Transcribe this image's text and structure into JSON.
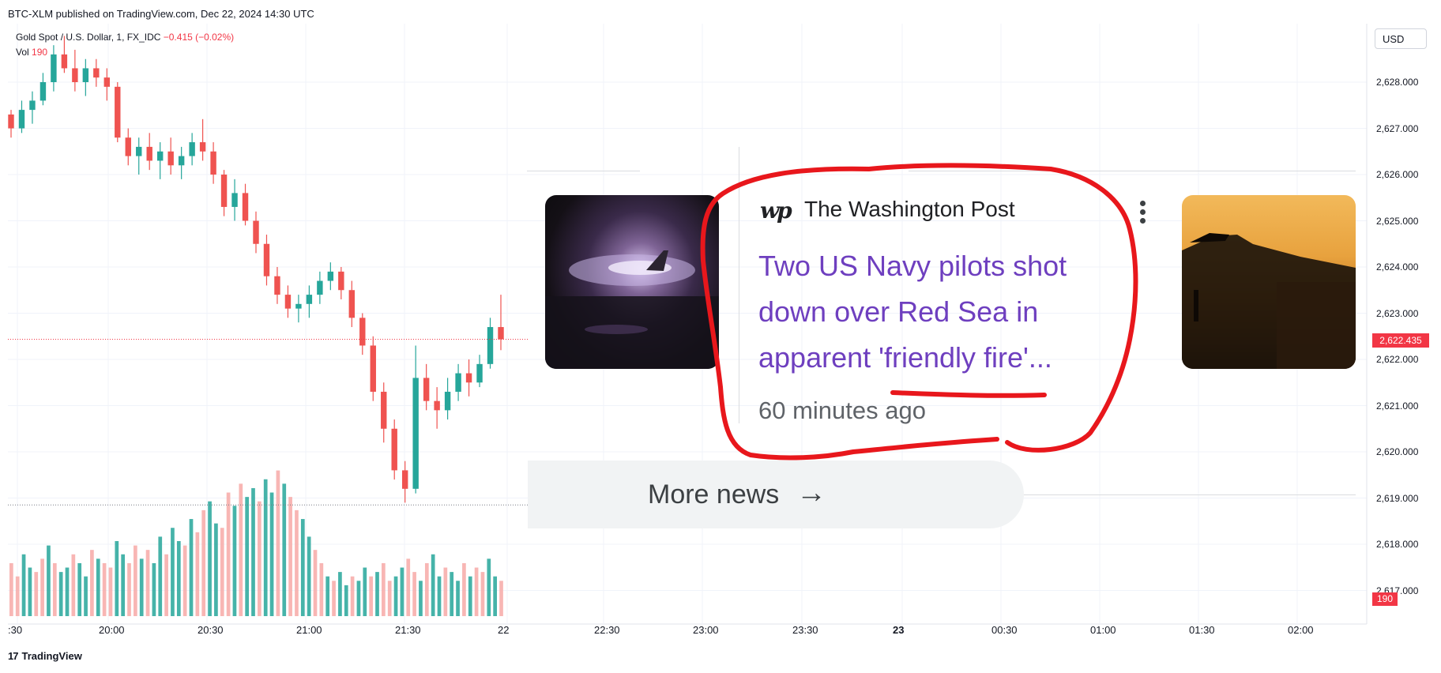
{
  "header": {
    "publish_line": "BTC-XLM published on TradingView.com, Dec 22, 2024 14:30 UTC"
  },
  "legend": {
    "symbol_line": "Gold Spot / U.S. Dollar, 1, FX_IDC",
    "change": "−0.415 (−0.02%)",
    "vol_label": "Vol",
    "vol_value": "190"
  },
  "currency_button": "USD",
  "price_axis": [
    "2,628.000",
    "2,627.000",
    "2,626.000",
    "2,625.000",
    "2,624.000",
    "2,623.000",
    "2,622.000",
    "2,621.000",
    "2,620.000",
    "2,619.000",
    "2,618.000",
    "2,617.000"
  ],
  "current_price": "2,622.435",
  "current_volume": "190",
  "time_axis": [
    ":30",
    "20:00",
    "20:30",
    "21:00",
    "21:30",
    "22",
    "22:30",
    "23:00",
    "23:30",
    "23",
    "00:30",
    "01:00",
    "01:30",
    "02:00"
  ],
  "footer": {
    "brand": "TradingView"
  },
  "news": {
    "source": "The Washington Post",
    "logo_text": "wp",
    "headline": "Two US Navy pilots shot down over Red Sea in apparent 'friendly fire'...",
    "time_ago": "60 minutes ago",
    "more_news": "More news"
  },
  "colors": {
    "up": "#26a69a",
    "down": "#ef5350",
    "accent": "#f23645",
    "headline": "#6e3fbf",
    "annotation": "#e8171c"
  },
  "chart_data": {
    "type": "candlestick",
    "symbol": "Gold Spot / U.S. Dollar",
    "interval": "1",
    "ylim": [
      2616.8,
      2629.0
    ],
    "last": 2622.435,
    "low_line": 2618.85,
    "ohlc": [
      [
        2627.3,
        2627.4,
        2626.8,
        2627.0
      ],
      [
        2627.0,
        2627.6,
        2626.9,
        2627.4
      ],
      [
        2627.4,
        2627.8,
        2627.1,
        2627.6
      ],
      [
        2627.6,
        2628.2,
        2627.5,
        2628.0
      ],
      [
        2628.0,
        2628.8,
        2627.8,
        2628.6
      ],
      [
        2628.6,
        2629.0,
        2628.2,
        2628.3
      ],
      [
        2628.3,
        2628.7,
        2627.8,
        2628.0
      ],
      [
        2628.0,
        2628.5,
        2627.7,
        2628.3
      ],
      [
        2628.3,
        2628.5,
        2627.9,
        2628.1
      ],
      [
        2628.1,
        2628.3,
        2627.6,
        2627.9
      ],
      [
        2627.9,
        2628.0,
        2626.7,
        2626.8
      ],
      [
        2626.8,
        2627.0,
        2626.2,
        2626.4
      ],
      [
        2626.4,
        2626.8,
        2626.0,
        2626.6
      ],
      [
        2626.6,
        2626.9,
        2626.1,
        2626.3
      ],
      [
        2626.3,
        2626.7,
        2625.9,
        2626.5
      ],
      [
        2626.5,
        2626.8,
        2626.0,
        2626.2
      ],
      [
        2626.2,
        2626.6,
        2625.9,
        2626.4
      ],
      [
        2626.4,
        2626.9,
        2626.2,
        2626.7
      ],
      [
        2626.7,
        2627.2,
        2626.3,
        2626.5
      ],
      [
        2626.5,
        2626.7,
        2625.8,
        2626.0
      ],
      [
        2626.0,
        2626.1,
        2625.1,
        2625.3
      ],
      [
        2625.3,
        2625.9,
        2625.0,
        2625.6
      ],
      [
        2625.6,
        2625.8,
        2624.9,
        2625.0
      ],
      [
        2625.0,
        2625.2,
        2624.3,
        2624.5
      ],
      [
        2624.5,
        2624.7,
        2623.6,
        2623.8
      ],
      [
        2623.8,
        2624.0,
        2623.2,
        2623.4
      ],
      [
        2623.4,
        2623.6,
        2622.9,
        2623.1
      ],
      [
        2623.1,
        2623.4,
        2622.8,
        2623.2
      ],
      [
        2623.2,
        2623.6,
        2622.9,
        2623.4
      ],
      [
        2623.4,
        2623.9,
        2623.2,
        2623.7
      ],
      [
        2623.7,
        2624.1,
        2623.5,
        2623.9
      ],
      [
        2623.9,
        2624.0,
        2623.3,
        2623.5
      ],
      [
        2623.5,
        2623.7,
        2622.7,
        2622.9
      ],
      [
        2622.9,
        2623.0,
        2622.1,
        2622.3
      ],
      [
        2622.3,
        2622.5,
        2621.1,
        2621.3
      ],
      [
        2621.3,
        2621.5,
        2620.2,
        2620.5
      ],
      [
        2620.5,
        2620.7,
        2619.4,
        2619.6
      ],
      [
        2619.6,
        2619.8,
        2618.9,
        2619.2
      ],
      [
        2619.2,
        2622.3,
        2619.1,
        2621.6
      ],
      [
        2621.6,
        2621.9,
        2620.9,
        2621.1
      ],
      [
        2621.1,
        2621.4,
        2620.5,
        2620.9
      ],
      [
        2620.9,
        2621.6,
        2620.7,
        2621.3
      ],
      [
        2621.3,
        2621.9,
        2621.1,
        2621.7
      ],
      [
        2621.7,
        2622.0,
        2621.2,
        2621.5
      ],
      [
        2621.5,
        2622.1,
        2621.4,
        2621.9
      ],
      [
        2621.9,
        2622.9,
        2621.8,
        2622.7
      ],
      [
        2622.7,
        2623.4,
        2622.2,
        2622.435
      ]
    ],
    "volume": [
      12,
      9,
      14,
      11,
      10,
      13,
      16,
      12,
      10,
      11,
      14,
      12,
      9,
      15,
      13,
      12,
      11,
      17,
      14,
      12,
      16,
      13,
      15,
      12,
      18,
      14,
      20,
      17,
      16,
      22,
      19,
      24,
      26,
      21,
      20,
      28,
      25,
      30,
      27,
      29,
      26,
      31,
      28,
      33,
      30,
      27,
      24,
      22,
      18,
      15,
      12,
      9,
      8,
      10,
      7,
      9,
      8,
      11,
      9,
      10,
      12,
      8,
      9,
      11,
      13,
      10,
      8,
      12,
      14,
      9,
      11,
      10,
      8,
      12,
      9,
      11,
      10,
      13,
      9,
      8
    ]
  }
}
